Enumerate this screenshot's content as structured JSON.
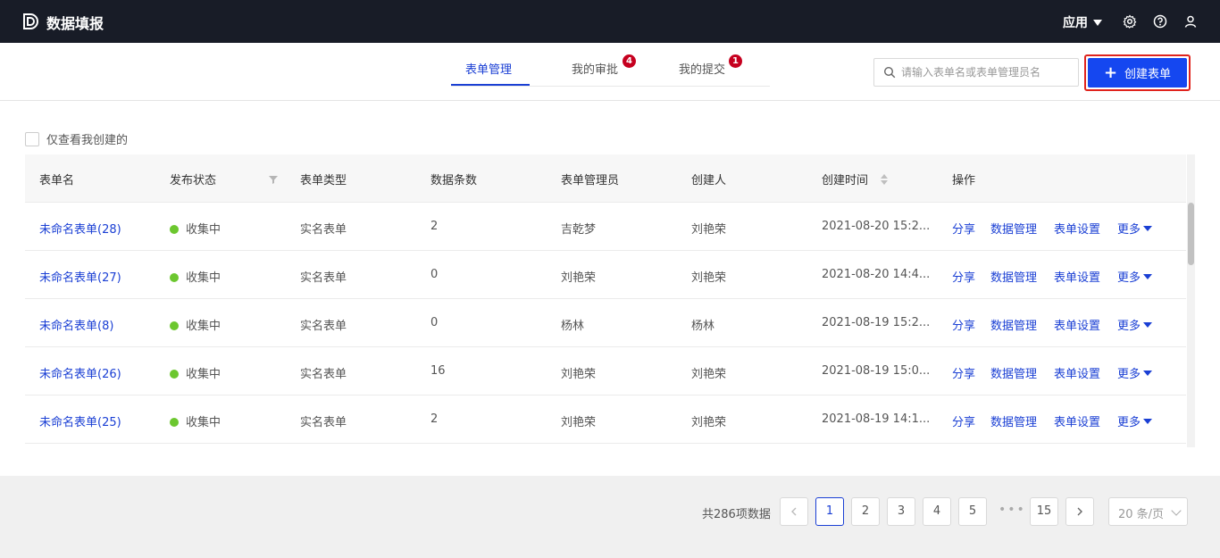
{
  "app": {
    "title": "数据填报",
    "menu_label": "应用"
  },
  "tabs": [
    {
      "label": "表单管理",
      "active": true
    },
    {
      "label": "我的审批",
      "badge": "4"
    },
    {
      "label": "我的提交",
      "badge": "1"
    }
  ],
  "search": {
    "placeholder": "请输入表单名或表单管理员名"
  },
  "create_button": {
    "label": "创建表单"
  },
  "filter": {
    "only_mine_label": "仅查看我创建的",
    "checked": false
  },
  "table": {
    "columns": [
      "表单名",
      "发布状态",
      "表单类型",
      "数据条数",
      "表单管理员",
      "创建人",
      "创建时间",
      "操作"
    ],
    "rows": [
      {
        "name": "未命名表单(28)",
        "status": "收集中",
        "type": "实名表单",
        "count": "2",
        "admin": "吉乾梦",
        "creator": "刘艳荣",
        "time": "2021-08-20 15:2..."
      },
      {
        "name": "未命名表单(27)",
        "status": "收集中",
        "type": "实名表单",
        "count": "0",
        "admin": "刘艳荣",
        "creator": "刘艳荣",
        "time": "2021-08-20 14:4..."
      },
      {
        "name": "未命名表单(8)",
        "status": "收集中",
        "type": "实名表单",
        "count": "0",
        "admin": "杨林",
        "creator": "杨林",
        "time": "2021-08-19 15:2..."
      },
      {
        "name": "未命名表单(26)",
        "status": "收集中",
        "type": "实名表单",
        "count": "16",
        "admin": "刘艳荣",
        "creator": "刘艳荣",
        "time": "2021-08-19 15:0..."
      },
      {
        "name": "未命名表单(25)",
        "status": "收集中",
        "type": "实名表单",
        "count": "2",
        "admin": "刘艳荣",
        "creator": "刘艳荣",
        "time": "2021-08-19 14:1..."
      }
    ],
    "actions": {
      "share": "分享",
      "data": "数据管理",
      "settings": "表单设置",
      "more": "更多"
    }
  },
  "pagination": {
    "total_text": "共286项数据",
    "pages": [
      "1",
      "2",
      "3",
      "4",
      "5"
    ],
    "last_page": "15",
    "current": "1",
    "ellipsis": "•••",
    "page_size": "20 条/页"
  },
  "colors": {
    "topbar": "#181c27",
    "accent": "#1547f0",
    "link": "#1a3fd4",
    "badge": "#c6001f",
    "status_dot": "#6cc72f",
    "highlight_border": "#e0231d"
  },
  "icons": [
    "logo-icon",
    "caret-down-icon",
    "gear-icon",
    "help-icon",
    "user-icon",
    "search-icon",
    "plus-icon",
    "filter-icon",
    "sort-icon",
    "chevron-left-icon",
    "chevron-right-icon",
    "chevron-down-icon"
  ]
}
